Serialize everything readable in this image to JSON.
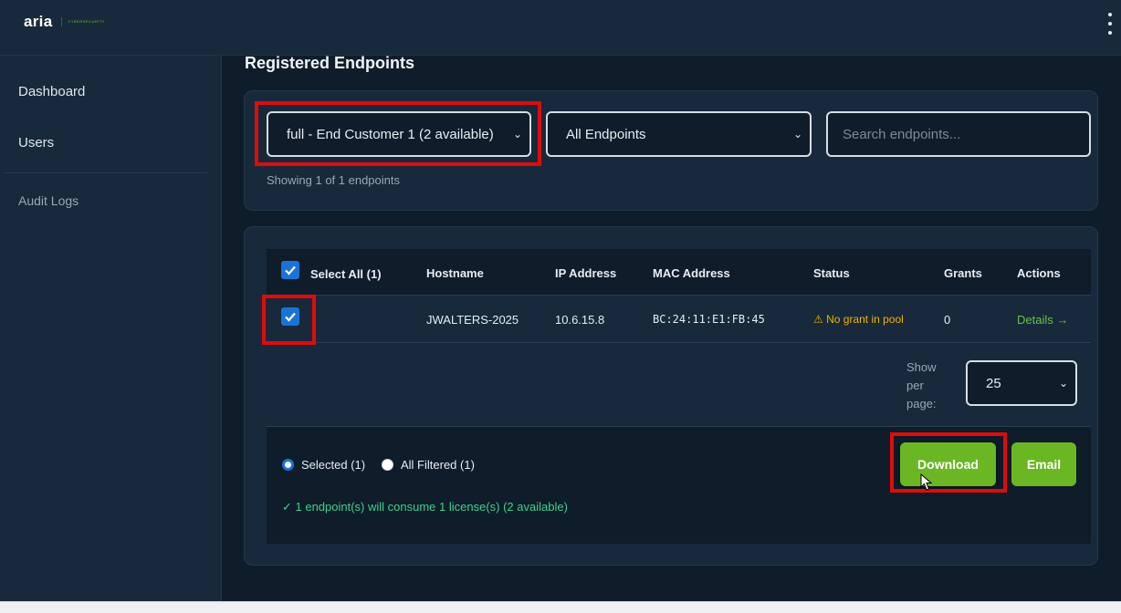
{
  "app": {
    "logo_text": "aria",
    "logo_tagline": "CYBERSECURITY"
  },
  "sidebar": {
    "items": [
      {
        "label": "Dashboard"
      },
      {
        "label": "Users"
      },
      {
        "label": "Audit Logs"
      }
    ]
  },
  "main": {
    "title": "Registered Endpoints",
    "filters": {
      "customer_select": "full - End Customer 1 (2 available)",
      "endpoint_type_select": "All Endpoints",
      "search_placeholder": "Search endpoints...",
      "showing_text": "Showing 1 of 1 endpoints"
    },
    "table": {
      "select_all_label": "Select All (1)",
      "columns": [
        "Hostname",
        "IP Address",
        "MAC Address",
        "Status",
        "Grants",
        "Actions"
      ],
      "rows": [
        {
          "checked": true,
          "hostname": "JWALTERS-2025",
          "ip": "10.6.15.8",
          "mac": "BC:24:11:E1:FB:45",
          "status": "⚠ No grant in pool",
          "grants": "0",
          "action": "Details →"
        }
      ]
    },
    "pagination": {
      "per_page_label": "Show per page:",
      "per_page_value": "25"
    },
    "export": {
      "option_selected": "Selected (1)",
      "option_filtered": "All Filtered (1)",
      "consume_text": "✓ 1 endpoint(s) will consume 1 license(s) (2 available)",
      "download_label": "Download",
      "email_label": "Email"
    }
  },
  "colors": {
    "accent_green": "#6ab723",
    "checkbox_blue": "#1a74d8",
    "highlight_red": "#e00b0b",
    "warning": "#f0b400"
  }
}
